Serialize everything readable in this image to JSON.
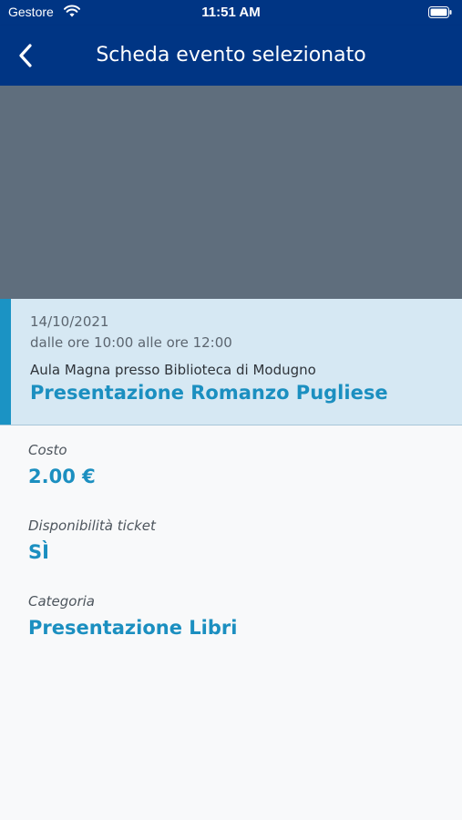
{
  "status_bar": {
    "carrier": "Gestore",
    "time": "11:51 AM",
    "wifi_icon": "wifi-icon",
    "battery_icon": "battery-icon"
  },
  "nav": {
    "title": "Scheda evento selezionato",
    "back_icon": "chevron-left-icon"
  },
  "event": {
    "date": "14/10/2021",
    "hours": "dalle ore 10:00 alle ore 12:00",
    "place": "Aula Magna presso Biblioteca di Modugno",
    "title": "Presentazione Romanzo Pugliese"
  },
  "details": {
    "cost_label": "Costo",
    "cost_value": "2.00 €",
    "ticket_label": "Disponibilità ticket",
    "ticket_value": "SÌ",
    "category_label": "Categoria",
    "category_value": "Presentazione Libri"
  },
  "colors": {
    "header": "#003584",
    "hero_placeholder": "#5f6e7d",
    "card_background": "#d6e8f3",
    "accent": "#1b93c4",
    "value_text": "#1b8fc0"
  }
}
